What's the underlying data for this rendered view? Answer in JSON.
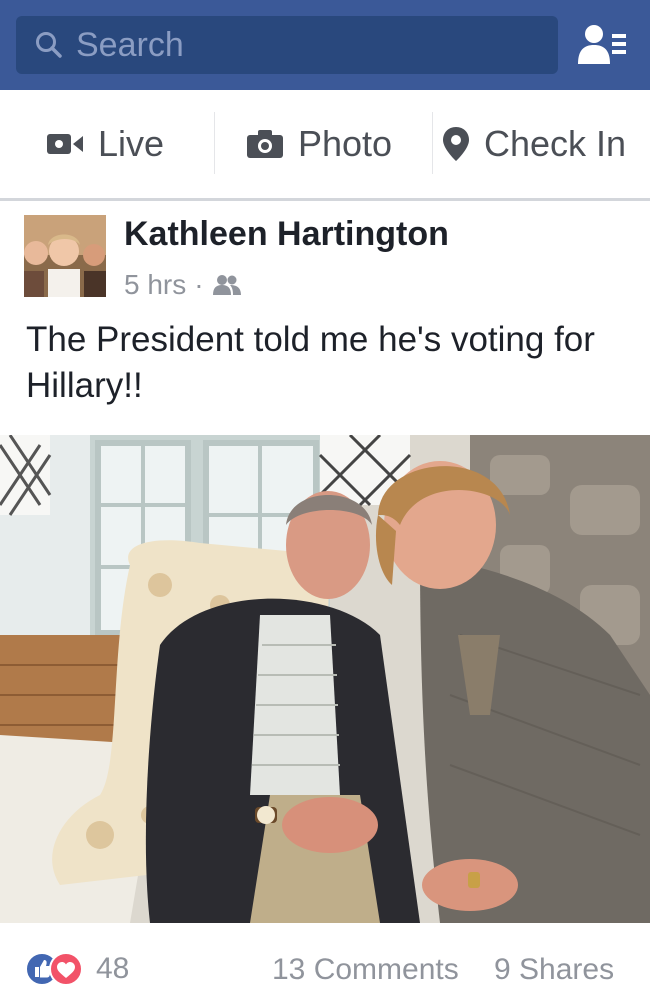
{
  "search": {
    "placeholder": "Search"
  },
  "composer": {
    "live_label": "Live",
    "photo_label": "Photo",
    "checkin_label": "Check In"
  },
  "post": {
    "author": "Kathleen Hartington",
    "time": "5 hrs",
    "separator": "·",
    "audience_icon": "friends-icon",
    "text": "The President told me he's voting for Hillary!!",
    "reactions_count": "48",
    "comments": "13 Comments",
    "shares": "9 Shares"
  },
  "colors": {
    "header": "#3b5998",
    "search_bg": "#29487d",
    "like_blue": "#4267b2",
    "love_red": "#f25268"
  }
}
